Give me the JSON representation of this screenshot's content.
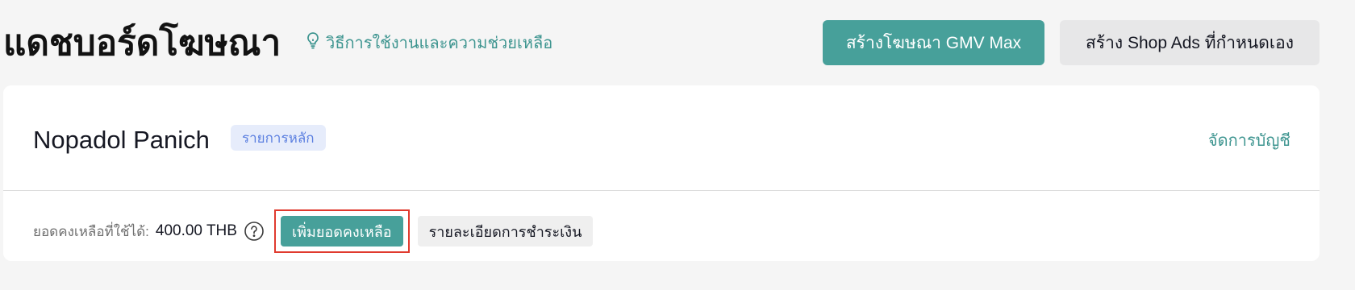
{
  "header": {
    "title": "แดชบอร์ดโฆษณา",
    "help_link": "วิธีการใช้งานและความช่วยเหลือ",
    "create_gmv_max_label": "สร้างโฆษณา GMV Max",
    "create_shop_ads_label": "สร้าง Shop Ads ที่กำหนดเอง"
  },
  "account": {
    "name": "Nopadol Panich",
    "badge": "รายการหลัก",
    "manage_link": "จัดการบัญชี",
    "balance_label": "ยอดคงเหลือที่ใช้ได้:",
    "balance_value": "400.00 THB",
    "topup_label": "เพิ่มยอดคงเหลือ",
    "payment_details_label": "รายละเอียดการชำระเงิน"
  },
  "colors": {
    "accent": "#47a09a",
    "link": "#3e9590",
    "highlight_border": "#e03a2e",
    "badge_bg": "#e6ecfb",
    "badge_text": "#5b7fe0"
  },
  "icons": {
    "help": "lightbulb-icon",
    "info": "question-circle-icon"
  }
}
